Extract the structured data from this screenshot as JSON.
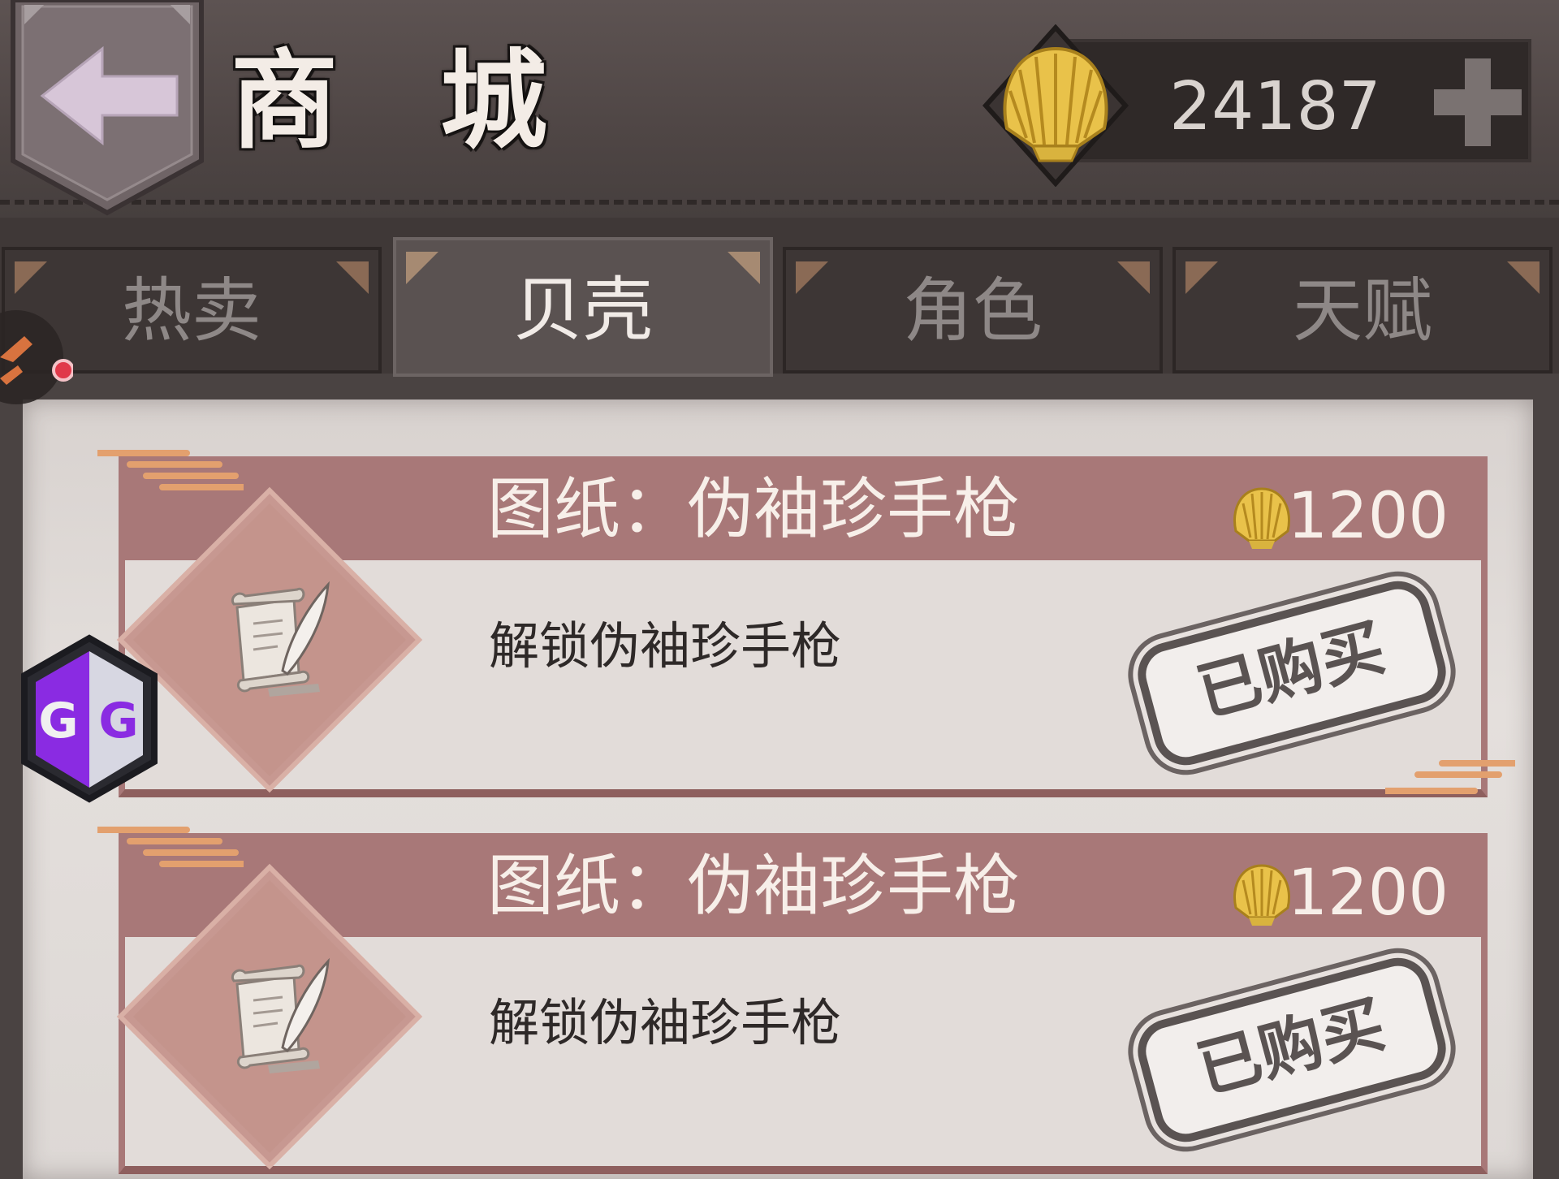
{
  "header": {
    "title": "商 城",
    "currency": {
      "icon": "shell-icon",
      "amount": "24187"
    },
    "back_icon": "back-arrow-icon",
    "add_icon": "plus-icon"
  },
  "tabs": [
    {
      "label": "热卖",
      "active": false
    },
    {
      "label": "贝壳",
      "active": true
    },
    {
      "label": "角色",
      "active": false
    },
    {
      "label": "天赋",
      "active": false
    }
  ],
  "items": [
    {
      "title": "图纸：伪袖珍手枪",
      "price": "1200",
      "description": "解锁伪袖珍手枪",
      "status": "已购买",
      "icon": "scroll-quill-icon"
    },
    {
      "title": "图纸：伪袖珍手枪",
      "price": "1200",
      "description": "解锁伪袖珍手枪",
      "status": "已购买",
      "icon": "scroll-quill-icon"
    }
  ],
  "overlay": {
    "gg_label": "GG"
  },
  "colors": {
    "card_header": "#a87878",
    "paper": "#e2dcd9",
    "header_bg": "#4f4645",
    "tab_active": "#5a5251"
  }
}
